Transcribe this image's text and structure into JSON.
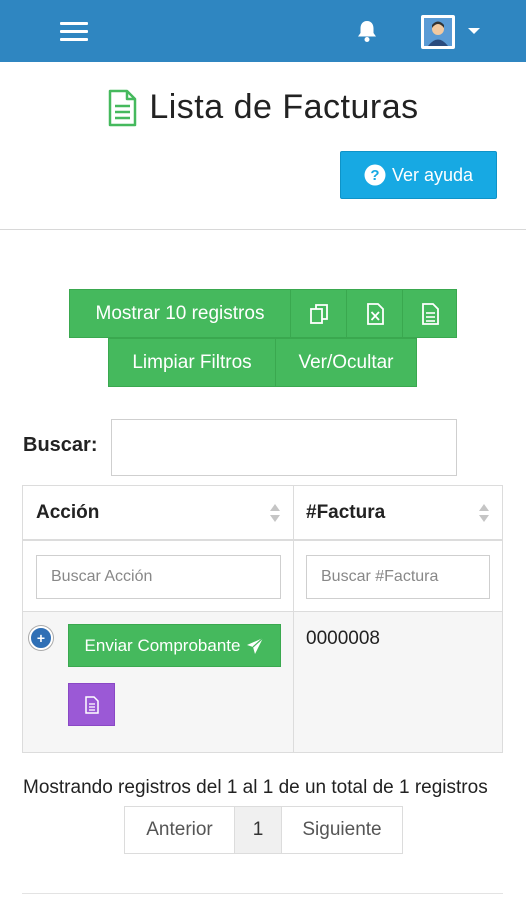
{
  "header": {
    "menu_icon": "hamburger-icon",
    "notification_icon": "bell-icon",
    "avatar_icon": "user-avatar",
    "dropdown_icon": "caret-down-icon"
  },
  "page": {
    "title": "Lista de Facturas",
    "title_icon": "document-icon",
    "help_label": "Ver ayuda",
    "help_icon": "question-circle-icon"
  },
  "toolbar": {
    "show_records_label": "Mostrar 10 registros",
    "copy_icon": "copy-icon",
    "excel_icon": "excel-file-icon",
    "pdf_icon": "document-icon",
    "clear_filters_label": "Limpiar Filtros",
    "toggle_columns_label": "Ver/Ocultar"
  },
  "search": {
    "label": "Buscar:",
    "value": ""
  },
  "table": {
    "columns": [
      "Acción",
      "#Factura"
    ],
    "filters": [
      "Buscar Acción",
      "Buscar #Factura"
    ],
    "rows": [
      {
        "expand_symbol": "+",
        "action_label": "Enviar Comprobante",
        "action_icon": "paper-plane-icon",
        "secondary_icon": "document-icon",
        "factura": "0000008"
      }
    ]
  },
  "footer": {
    "info": "Mostrando registros del 1 al 1 de un total de 1 registros",
    "prev_label": "Anterior",
    "page": "1",
    "next_label": "Siguiente"
  },
  "colors": {
    "header_bg": "#2f86c1",
    "help_btn": "#17a9e3",
    "green_btn": "#45b95d",
    "purple_btn": "#9b59d6",
    "doc_icon": "#45b95d"
  }
}
